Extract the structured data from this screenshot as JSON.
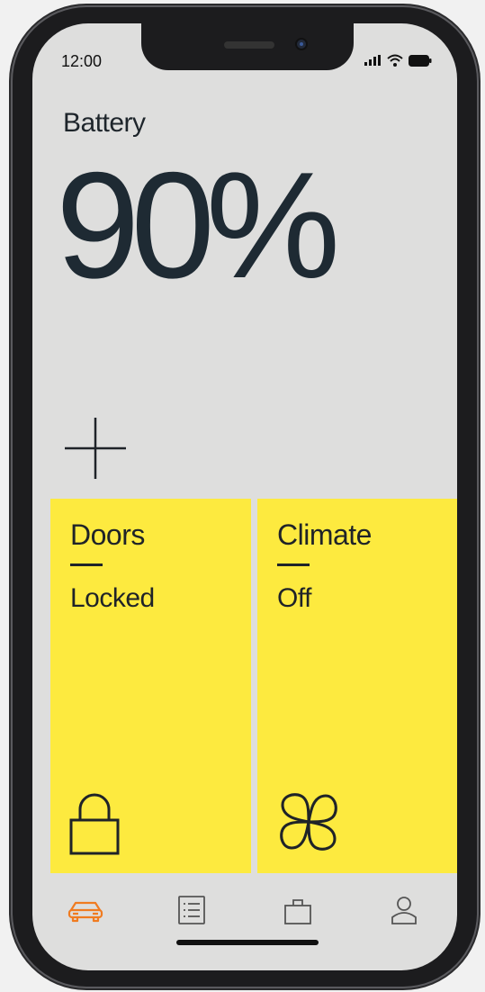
{
  "status_bar": {
    "time": "12:00"
  },
  "battery": {
    "label": "Battery",
    "value": "90%"
  },
  "tiles": [
    {
      "title": "Doors",
      "value": "Locked",
      "icon": "lock-icon"
    },
    {
      "title": "Climate",
      "value": "Off",
      "icon": "fan-icon"
    }
  ],
  "nav": {
    "items": [
      {
        "icon": "car-icon",
        "active": true
      },
      {
        "icon": "list-icon",
        "active": false
      },
      {
        "icon": "bag-icon",
        "active": false
      },
      {
        "icon": "profile-icon",
        "active": false
      }
    ]
  },
  "colors": {
    "accent": "#f07b20",
    "tile": "#fdea3f",
    "screen": "#dededd",
    "text": "#1e2a33"
  }
}
